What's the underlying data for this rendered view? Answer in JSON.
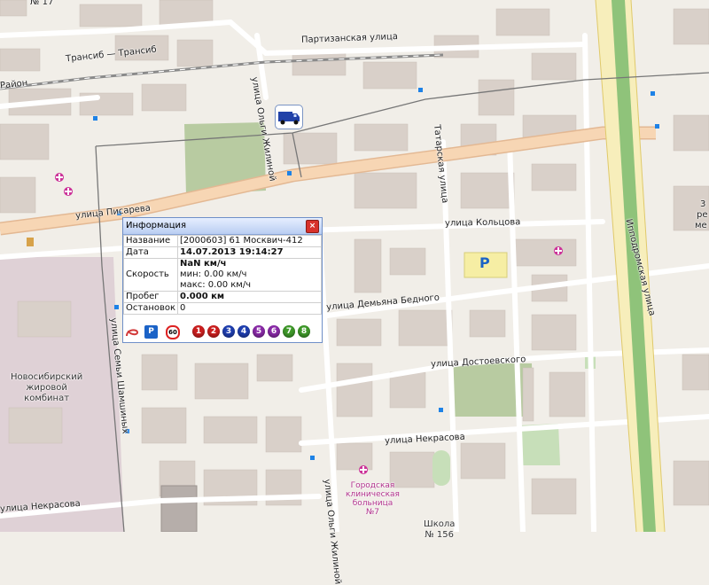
{
  "map": {
    "streets": [
      "Трансиб — Трансиб",
      "Партизанская улица",
      "улица Ольги Жилиной",
      "Татарская улица",
      "улица Писарева",
      "улица Кольцова",
      "Ипподромская улица",
      "улица Демьяна Бедного",
      "улица Семьи Шамшиных",
      "улица Достоевского",
      "улица Некрасова",
      "улица Некрасова",
      "улица Ольги Жилиной"
    ],
    "edge_labels": [
      "№ 17",
      "Район",
      "3",
      "ре",
      "ме"
    ],
    "districts": [
      "Новосибирский\nжировой\nкомбинат"
    ],
    "hospital": "Городская\nклиническая\nбольница\n№7",
    "school": "Школа\n№ 156",
    "parking": "P",
    "colors": {
      "road_major": "#f7d6b4",
      "road_major_border": "#e3b893",
      "highway": "#8fc37a",
      "building": "#d9d0c9",
      "industrial": "#dfd1d6",
      "park": "#b8cba1",
      "green": "#c7dfb9"
    }
  },
  "vehicle": {
    "icon": "truck-icon"
  },
  "popup": {
    "title": "Информация",
    "close": "×",
    "rows": {
      "name_label": "Название",
      "name_value": "[2000603] 61 Москвич-412",
      "date_label": "Дата",
      "date_value": "14.07.2013 19:14:27",
      "speed_label": "Скорость",
      "speed_value": "NaN км/ч",
      "speed_min": "мин: 0.00 км/ч",
      "speed_max": "макс: 0.00 км/ч",
      "mileage_label": "Пробег",
      "mileage_value": "0.000 км",
      "stops_label": "Остановок",
      "stops_value": "0"
    },
    "icons": {
      "parking": "P",
      "speed_limit": "60",
      "numbers": [
        "1",
        "2",
        "3",
        "4",
        "5",
        "6",
        "7",
        "8"
      ],
      "number_colors": [
        "#cc1f1f",
        "#cc1f1f",
        "#1f3fb0",
        "#1f3fb0",
        "#8a2aa8",
        "#8a2aa8",
        "#3f9a2a",
        "#3f9a2a"
      ]
    }
  }
}
